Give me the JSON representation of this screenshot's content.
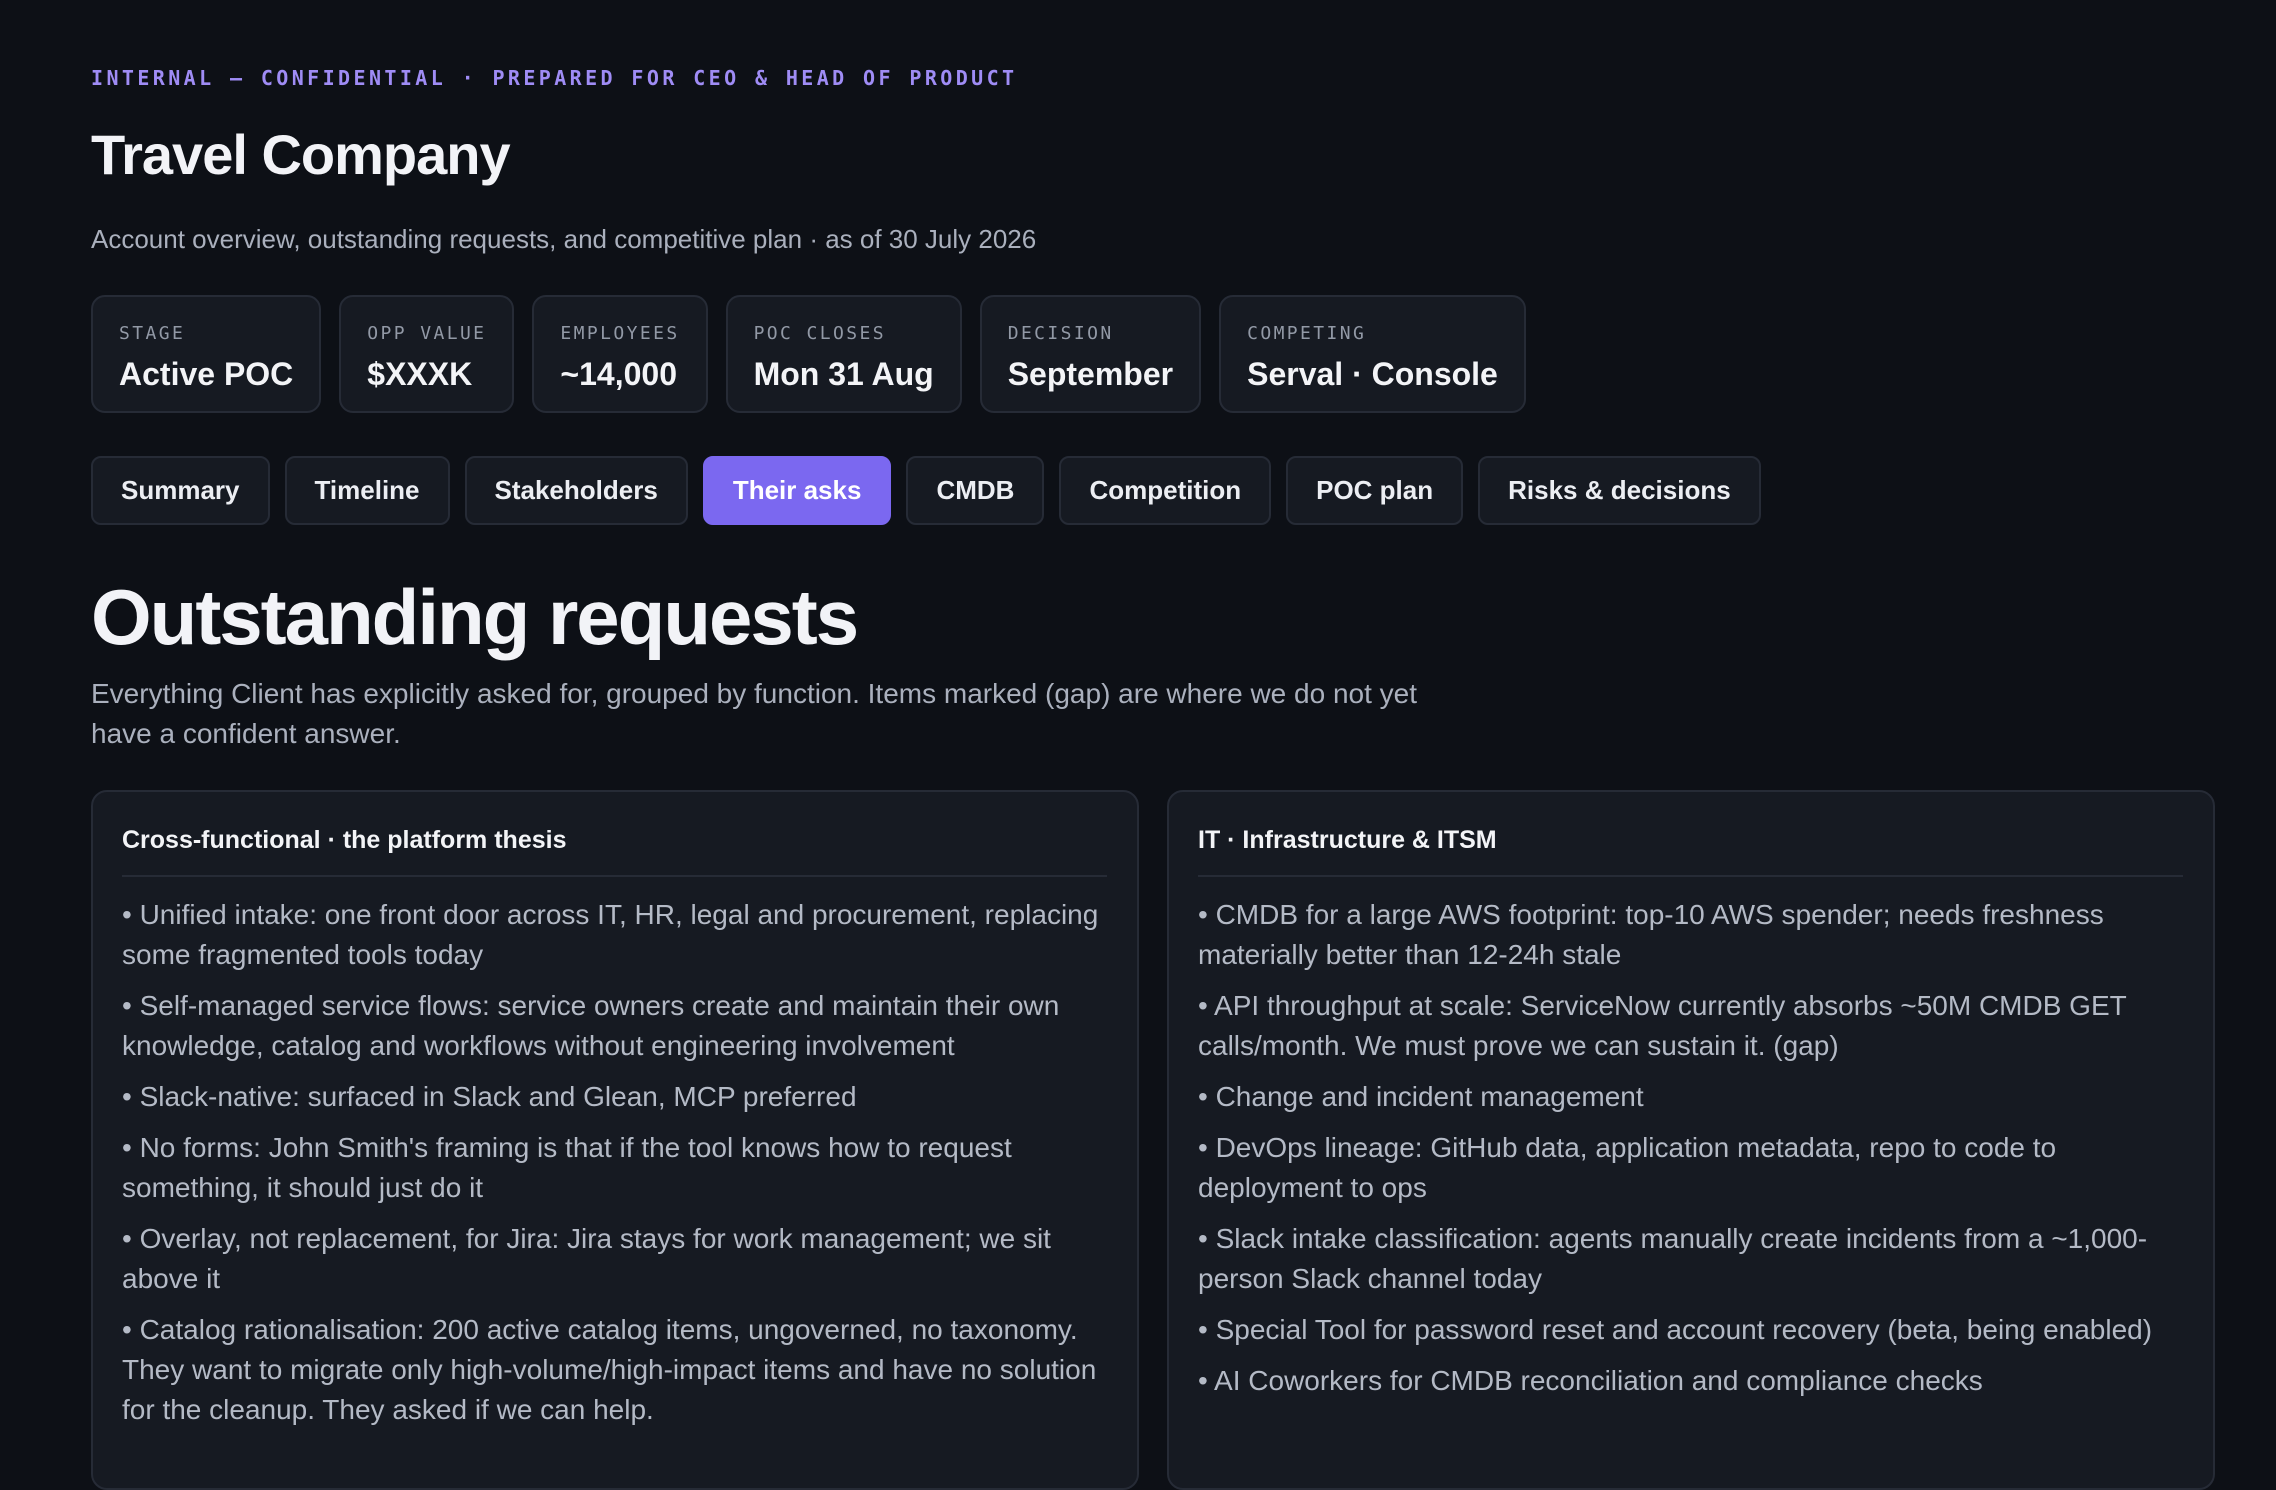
{
  "header": {
    "eyebrow": "INTERNAL — CONFIDENTIAL · PREPARED FOR CEO & HEAD OF PRODUCT",
    "title": "Travel Company",
    "subtitle": "Account overview, outstanding requests, and competitive plan · as of 30 July 2026"
  },
  "stats": [
    {
      "label": "STAGE",
      "value": "Active POC"
    },
    {
      "label": "OPP VALUE",
      "value": "$XXXK"
    },
    {
      "label": "EMPLOYEES",
      "value": "~14,000"
    },
    {
      "label": "POC CLOSES",
      "value": "Mon 31 Aug"
    },
    {
      "label": "DECISION",
      "value": "September"
    },
    {
      "label": "COMPETING",
      "value": "Serval · Console"
    }
  ],
  "tabs": [
    {
      "label": "Summary",
      "active": false
    },
    {
      "label": "Timeline",
      "active": false
    },
    {
      "label": "Stakeholders",
      "active": false
    },
    {
      "label": "Their asks",
      "active": true
    },
    {
      "label": "CMDB",
      "active": false
    },
    {
      "label": "Competition",
      "active": false
    },
    {
      "label": "POC plan",
      "active": false
    },
    {
      "label": "Risks & decisions",
      "active": false
    }
  ],
  "section": {
    "title": "Outstanding requests",
    "description": "Everything Client has explicitly asked for, grouped by function. Items marked (gap) are where we do not yet have a confident answer."
  },
  "cards": [
    {
      "title": "Cross-functional · the platform thesis",
      "items": [
        "• Unified intake: one front door across IT, HR, legal and procurement, replacing some fragmented tools today",
        "• Self-managed service flows: service owners create and maintain their own knowledge, catalog and workflows without engineering involvement",
        "• Slack-native: surfaced in Slack and Glean, MCP preferred",
        "• No forms: John Smith's framing is that if the tool knows how to request something, it should just do it",
        "• Overlay, not replacement, for Jira: Jira stays for work management; we sit above it",
        "• Catalog rationalisation: 200 active catalog items, ungoverned, no taxonomy. They want to migrate only high-volume/high-impact items and have no solution for the cleanup. They asked if we can help."
      ]
    },
    {
      "title": "IT · Infrastructure & ITSM",
      "items": [
        "• CMDB for a large AWS footprint: top-10 AWS spender; needs freshness materially better than 12-24h stale",
        "• API throughput at scale: ServiceNow currently absorbs ~50M CMDB GET calls/month. We must prove we can sustain it. (gap)",
        "• Change and incident management",
        "• DevOps lineage: GitHub data, application metadata, repo to code to deployment to ops",
        "• Slack intake classification: agents manually create incidents from a ~1,000-person Slack channel today",
        "• Special Tool for password reset and account recovery (beta, being enabled)",
        "• AI Coworkers for CMDB reconciliation and compliance checks"
      ]
    }
  ]
}
